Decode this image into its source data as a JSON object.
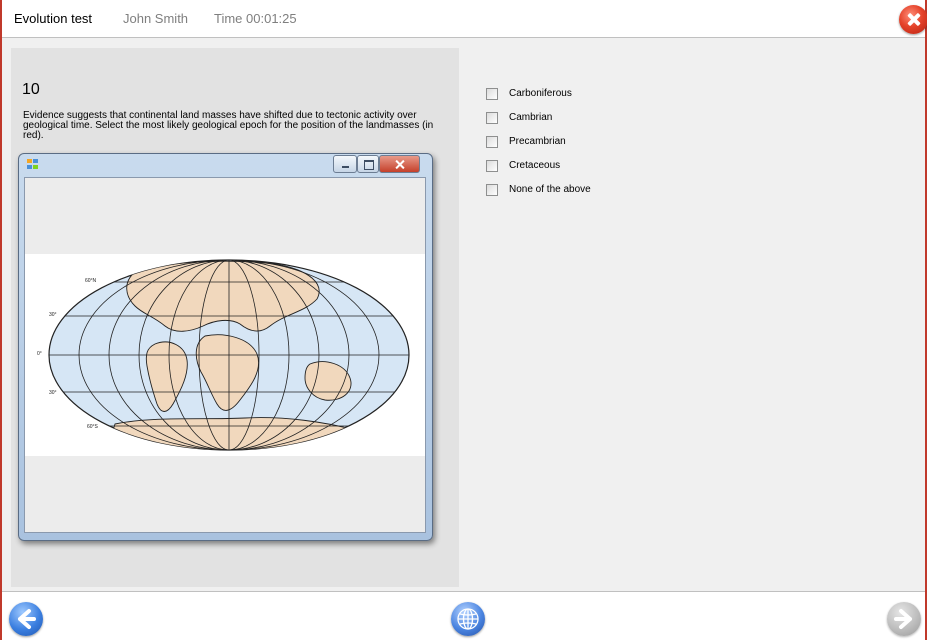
{
  "header": {
    "title": "Evolution  test",
    "user": "John Smith",
    "timer": "Time 00:01:25"
  },
  "question": {
    "number": "10",
    "text": "Evidence suggests that continental land masses have shifted due to tectonic activity over geological time. Select the most likely geological epoch for the position of the landmasses (in red)."
  },
  "map_labels": {
    "lat_60n": "60°N",
    "lat_30": "30°",
    "lat_0": "0°",
    "lat_30s": "30°",
    "lat_60s": "60°S"
  },
  "options": [
    {
      "label": "Carboniferous",
      "checked": false
    },
    {
      "label": "Cambrian",
      "checked": false
    },
    {
      "label": "Precambrian",
      "checked": false
    },
    {
      "label": "Cretaceous",
      "checked": false
    },
    {
      "label": "None of the above",
      "checked": false
    }
  ],
  "icons": {
    "close": "close-icon",
    "back": "back-arrow-icon",
    "globe": "globe-icon",
    "next": "next-arrow-icon",
    "window_app": "app-icon"
  },
  "colors": {
    "frame_border": "#c0392b",
    "ocean": "#d6e6f5",
    "land": "#f1d8bd",
    "panel": "#e2e2e2"
  }
}
